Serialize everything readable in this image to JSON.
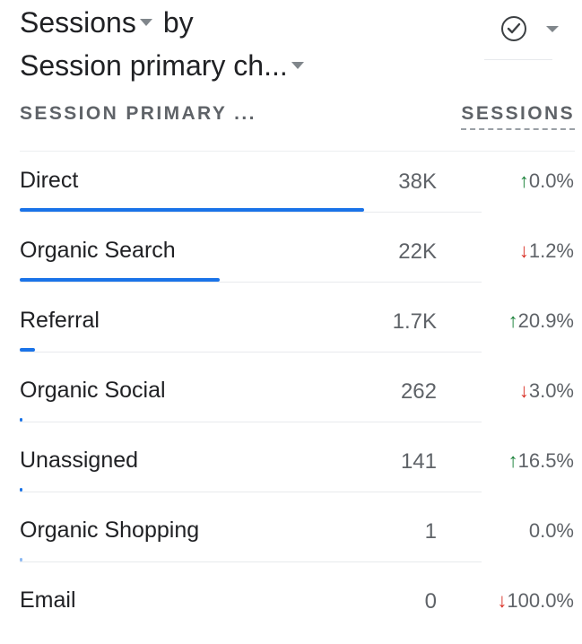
{
  "title": {
    "metric": "Sessions",
    "by": "by",
    "dimension": "Session primary ch..."
  },
  "toolbar": {
    "compare_icon": "check-circle-icon",
    "menu_icon": "caret-down-icon"
  },
  "table": {
    "headers": {
      "dimension": "SESSION PRIMARY ...",
      "metric": "SESSIONS"
    },
    "colors": {
      "bar": "#1a73e8",
      "up": "#188038",
      "down": "#d93025"
    },
    "rows": [
      {
        "channel": "Direct",
        "value": "38K",
        "direction": "up",
        "arrow": "↑",
        "change": "0.0%",
        "share": 1.0
      },
      {
        "channel": "Organic Search",
        "value": "22K",
        "direction": "down",
        "arrow": "↓",
        "change": "1.2%",
        "share": 0.58
      },
      {
        "channel": "Referral",
        "value": "1.7K",
        "direction": "up",
        "arrow": "↑",
        "change": "20.9%",
        "share": 0.045
      },
      {
        "channel": "Organic Social",
        "value": "262",
        "direction": "down",
        "arrow": "↓",
        "change": "3.0%",
        "share": 0.007
      },
      {
        "channel": "Unassigned",
        "value": "141",
        "direction": "up",
        "arrow": "↑",
        "change": "16.5%",
        "share": 0.004
      },
      {
        "channel": "Organic Shopping",
        "value": "1",
        "direction": "none",
        "arrow": "",
        "change": "0.0%",
        "share": 0.0
      },
      {
        "channel": "Email",
        "value": "0",
        "direction": "down",
        "arrow": "↓",
        "change": "100.0%",
        "share": 0.0
      }
    ]
  }
}
